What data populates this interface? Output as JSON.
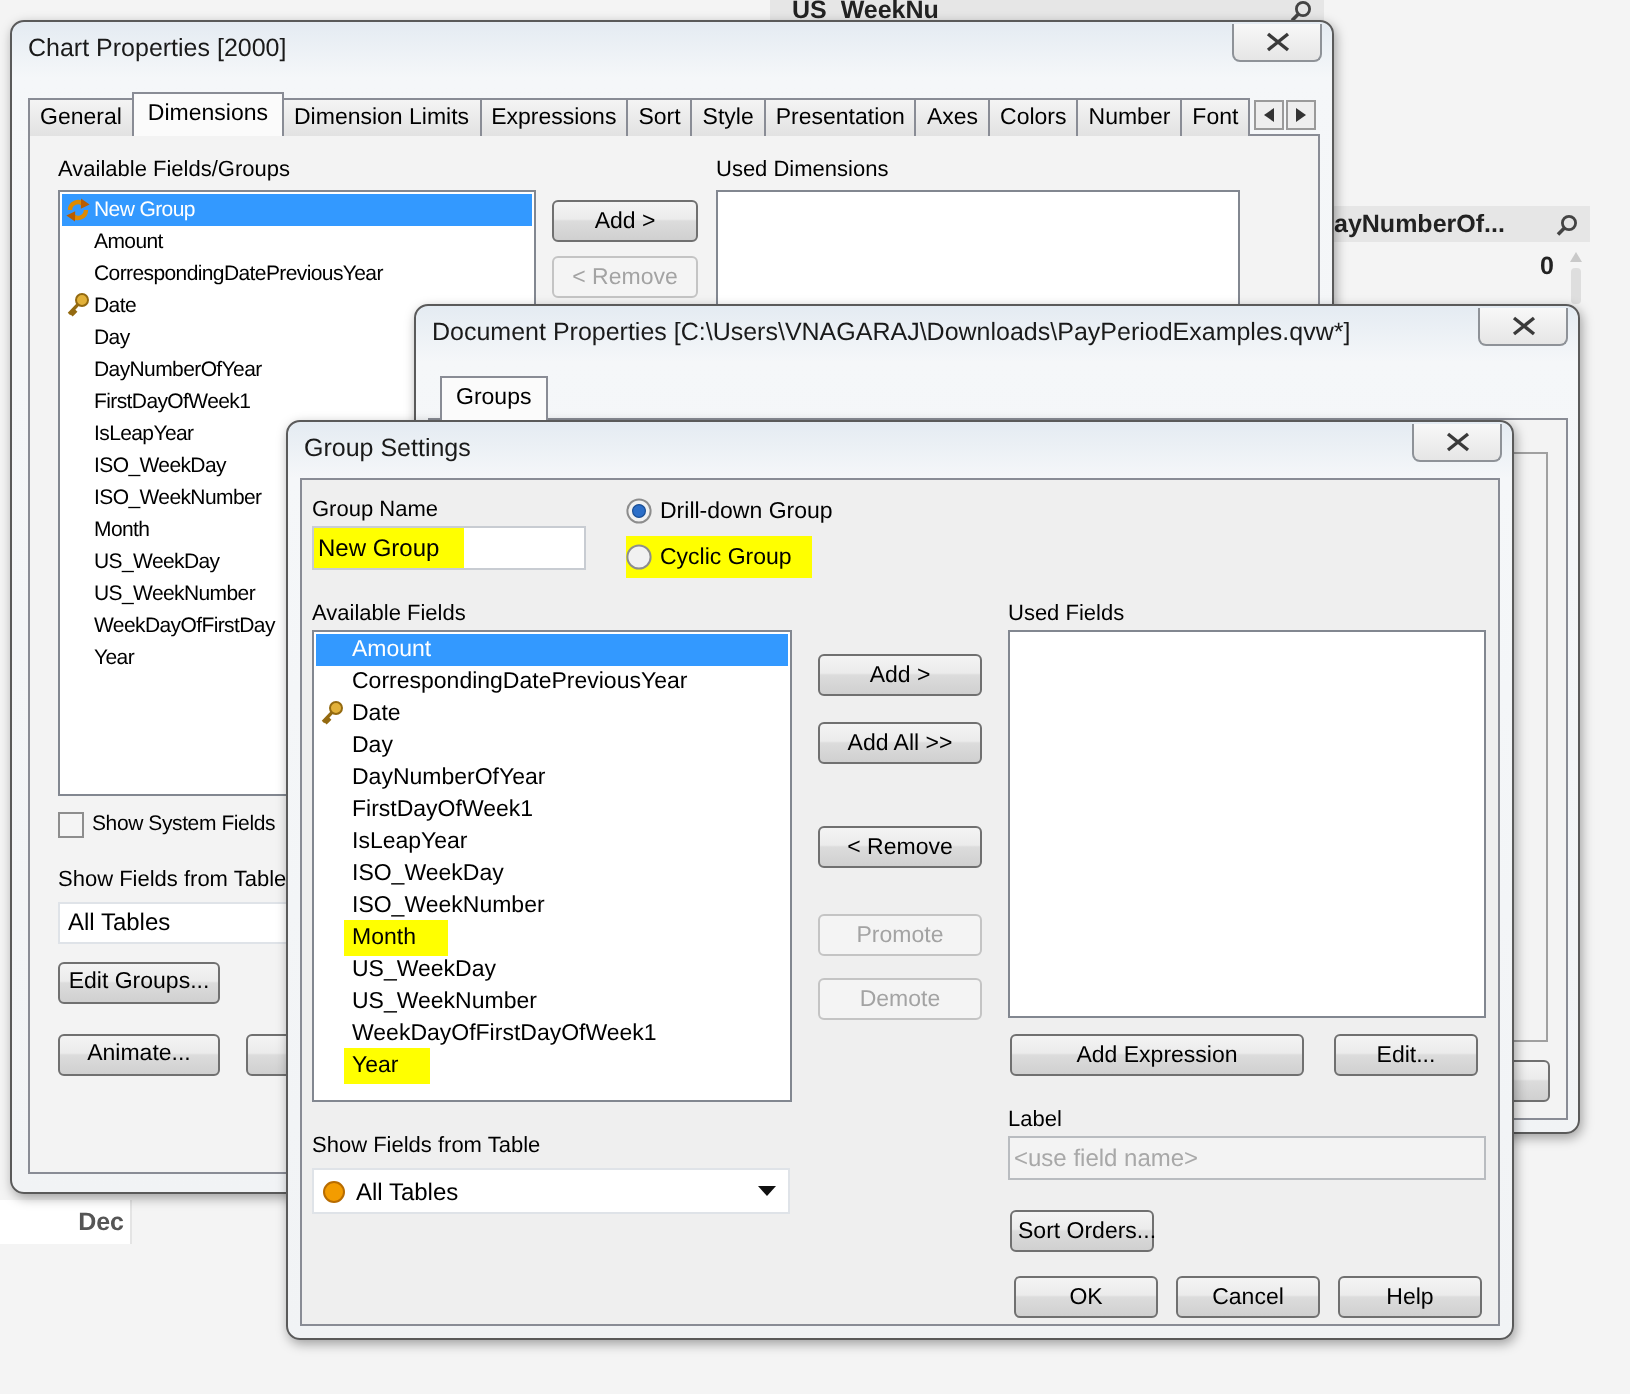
{
  "background": {
    "list_headers": [
      {
        "title": "US_WeekNu"
      },
      {
        "title": "ayNumberOf..."
      }
    ],
    "list_values": [
      "0"
    ],
    "table_cell": "Dec"
  },
  "chart_properties": {
    "title": "Chart Properties [2000]",
    "tabs": [
      {
        "label": "General",
        "selected": false
      },
      {
        "label": "Dimensions",
        "selected": true
      },
      {
        "label": "Dimension Limits",
        "selected": false
      },
      {
        "label": "Expressions",
        "selected": false
      },
      {
        "label": "Sort",
        "selected": false
      },
      {
        "label": "Style",
        "selected": false
      },
      {
        "label": "Presentation",
        "selected": false
      },
      {
        "label": "Axes",
        "selected": false
      },
      {
        "label": "Colors",
        "selected": false
      },
      {
        "label": "Number",
        "selected": false
      },
      {
        "label": "Font",
        "selected": false
      }
    ],
    "available_label": "Available Fields/Groups",
    "available_fields": [
      {
        "label": "New Group",
        "kind": "group",
        "selected": true
      },
      {
        "label": "Amount",
        "kind": "field",
        "selected": false
      },
      {
        "label": "CorrespondingDatePreviousYear",
        "kind": "field",
        "selected": false
      },
      {
        "label": "Date",
        "kind": "key",
        "selected": false
      },
      {
        "label": "Day",
        "kind": "field",
        "selected": false
      },
      {
        "label": "DayNumberOfYear",
        "kind": "field",
        "selected": false
      },
      {
        "label": "FirstDayOfWeek1",
        "kind": "field",
        "selected": false
      },
      {
        "label": "IsLeapYear",
        "kind": "field",
        "selected": false
      },
      {
        "label": "ISO_WeekDay",
        "kind": "field",
        "selected": false
      },
      {
        "label": "ISO_WeekNumber",
        "kind": "field",
        "selected": false
      },
      {
        "label": "Month",
        "kind": "field",
        "selected": false
      },
      {
        "label": "US_WeekDay",
        "kind": "field",
        "selected": false
      },
      {
        "label": "US_WeekNumber",
        "kind": "field",
        "selected": false
      },
      {
        "label": "WeekDayOfFirstDay",
        "kind": "field",
        "selected": false
      },
      {
        "label": "Year",
        "kind": "field",
        "selected": false
      }
    ],
    "move_buttons": [
      {
        "label": "Add >",
        "disabled": false
      },
      {
        "label": "< Remove",
        "disabled": true
      }
    ],
    "used_label": "Used Dimensions",
    "show_system_fields": {
      "label": "Show System Fields",
      "checked": false
    },
    "table_label": "Show Fields from Table",
    "table_dropdown": {
      "value": "All Tables",
      "kind": "plain"
    },
    "buttons": [
      {
        "label": "Edit Groups...",
        "disabled": false
      },
      {
        "label": "Animate...",
        "disabled": false
      }
    ]
  },
  "document_properties": {
    "title": "Document Properties [C:\\Users\\VNAGARAJ\\Downloads\\PayPeriodExamples.qvw*]",
    "tabs": [
      {
        "label": "Groups",
        "selected": true
      }
    ]
  },
  "group_settings": {
    "title": "Group Settings",
    "name_label": "Group Name",
    "name_field": {
      "value": "New Group",
      "highlighted": true
    },
    "group_types": [
      {
        "label": "Drill-down Group",
        "selected": true,
        "highlighted": false
      },
      {
        "label": "Cyclic Group",
        "selected": false,
        "highlighted": true
      }
    ],
    "available_label": "Available Fields",
    "available_fields": [
      {
        "label": "Amount",
        "kind": "field",
        "selected": true,
        "highlighted": false
      },
      {
        "label": "CorrespondingDatePreviousYear",
        "kind": "field",
        "selected": false,
        "highlighted": false
      },
      {
        "label": "Date",
        "kind": "key",
        "selected": false,
        "highlighted": false
      },
      {
        "label": "Day",
        "kind": "field",
        "selected": false,
        "highlighted": false
      },
      {
        "label": "DayNumberOfYear",
        "kind": "field",
        "selected": false,
        "highlighted": false
      },
      {
        "label": "FirstDayOfWeek1",
        "kind": "field",
        "selected": false,
        "highlighted": false
      },
      {
        "label": "IsLeapYear",
        "kind": "field",
        "selected": false,
        "highlighted": false
      },
      {
        "label": "ISO_WeekDay",
        "kind": "field",
        "selected": false,
        "highlighted": false
      },
      {
        "label": "ISO_WeekNumber",
        "kind": "field",
        "selected": false,
        "highlighted": false
      },
      {
        "label": "Month",
        "kind": "field",
        "selected": false,
        "highlighted": true
      },
      {
        "label": "US_WeekDay",
        "kind": "field",
        "selected": false,
        "highlighted": false
      },
      {
        "label": "US_WeekNumber",
        "kind": "field",
        "selected": false,
        "highlighted": false
      },
      {
        "label": "WeekDayOfFirstDayOfWeek1",
        "kind": "field",
        "selected": false,
        "highlighted": false
      },
      {
        "label": "Year",
        "kind": "field",
        "selected": false,
        "highlighted": true
      }
    ],
    "move_buttons": [
      {
        "label": "Add >",
        "disabled": false
      },
      {
        "label": "Add All >>",
        "disabled": false
      },
      {
        "label": "< Remove",
        "disabled": false
      },
      {
        "label": "Promote",
        "disabled": true
      },
      {
        "label": "Demote",
        "disabled": true
      }
    ],
    "used_label": "Used Fields",
    "used_buttons": [
      {
        "label": "Add Expression",
        "disabled": false
      },
      {
        "label": "Edit...",
        "disabled": false
      }
    ],
    "label_label": "Label",
    "label_field": {
      "placeholder": "<use field name>",
      "disabled": true
    },
    "table_label": "Show Fields from Table",
    "table_dropdown": {
      "value": "All Tables",
      "kind": "dotted"
    },
    "sort_button": {
      "label": "Sort Orders...",
      "disabled": false
    },
    "dialog_buttons": [
      {
        "label": "OK",
        "disabled": false
      },
      {
        "label": "Cancel",
        "disabled": false
      },
      {
        "label": "Help",
        "disabled": false
      }
    ]
  }
}
